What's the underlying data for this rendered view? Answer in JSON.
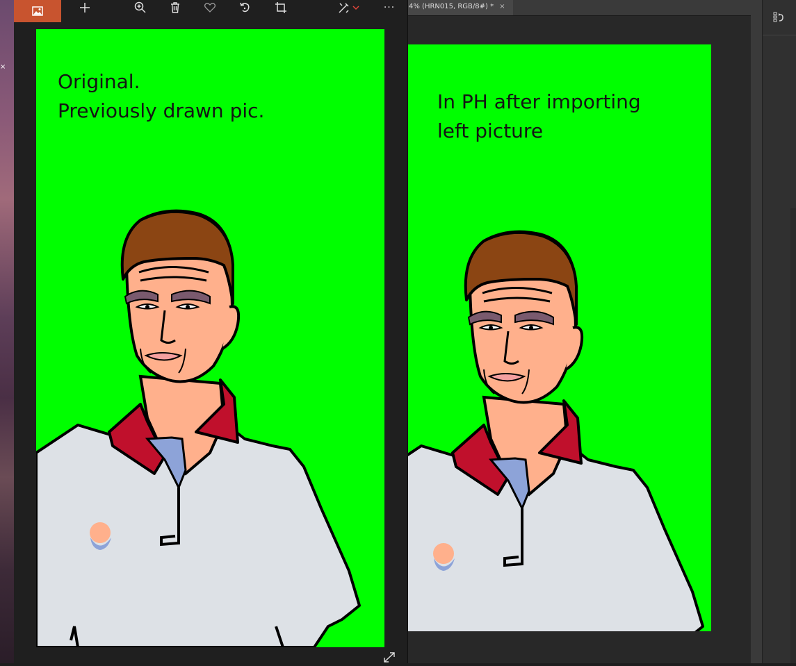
{
  "photos_viewer": {
    "toolbar": {
      "icons": [
        "image-icon",
        "add-icon",
        "zoom-in-icon",
        "delete-icon",
        "favorite-icon",
        "rotate-icon",
        "crop-icon",
        "edit-icon",
        "chevron-down-icon",
        "more-icon"
      ],
      "more_label": "···"
    },
    "caption": {
      "line1": "Original.",
      "line2": "Previously drawn pic."
    }
  },
  "photoshop": {
    "tab_title": "4% (HRN015, RGB/8#) *",
    "tab_close": "×",
    "caption": {
      "line1": "In PH after importing",
      "line2": "left picture"
    },
    "panel_icon": "history-icon"
  },
  "desktop": {
    "close_glyph": "×"
  },
  "colors": {
    "canvas_green": "#00ff00",
    "accent_orange": "#c8542f",
    "skin": "#ffb08c",
    "hair": "#8b4513",
    "collar_red": "#c0102c",
    "shirt": "#dde1e6"
  }
}
